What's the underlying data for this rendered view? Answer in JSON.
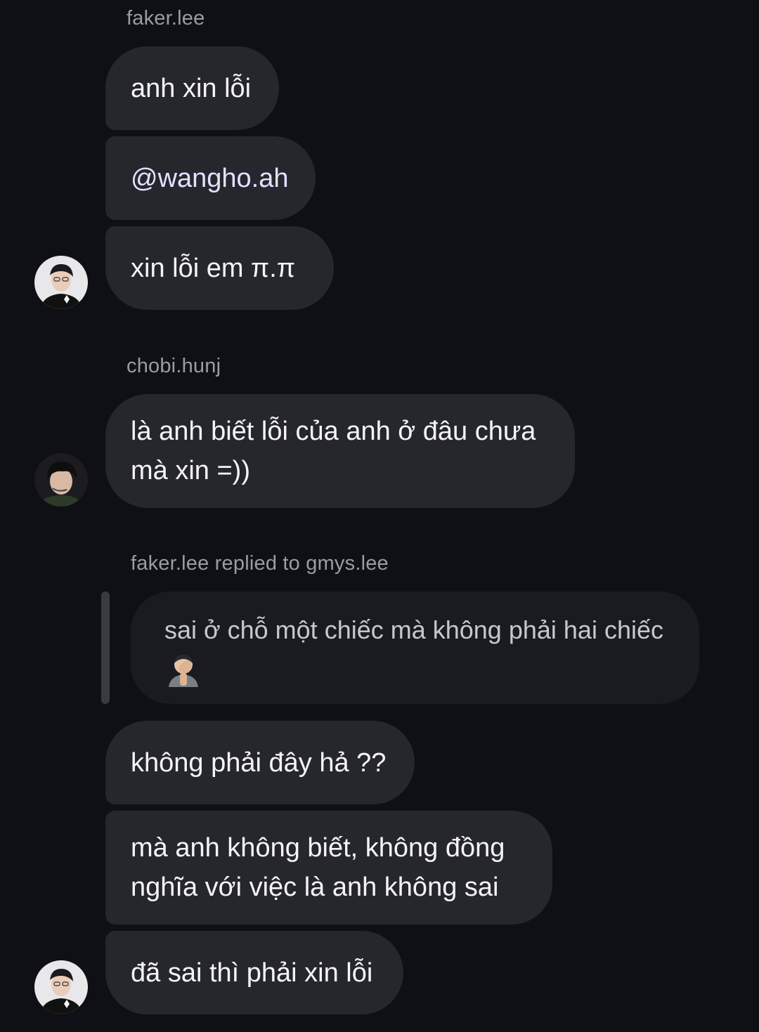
{
  "groups": [
    {
      "sender": "faker.lee",
      "messages": [
        "anh xin lỗi",
        "@wangho.ah",
        "xin lỗi em π.π"
      ],
      "avatar": "faker-avatar-icon"
    },
    {
      "sender": "chobi.hunj",
      "messages": [
        "là anh biết lỗi của anh ở đâu chưa",
        "mà xin =))"
      ],
      "avatar": "chobi-avatar-icon"
    }
  ],
  "reply": {
    "header": "faker.lee replied to gmys.lee",
    "quoted_text": "sai ở chỗ một chiếc mà không phải hai chiếc",
    "quoted_emoji": "face-palm-icon"
  },
  "faker_messages": [
    "không phải đây hả ??",
    "mà anh không biết, không đồng",
    "nghĩa với việc là anh không sai",
    "đã sai thì phải xin lỗi"
  ],
  "colors": {
    "background": "#0f1016",
    "bubble": "#26272d",
    "reply_bubble": "#1a1b20",
    "name_text": "#9a9ca5"
  }
}
